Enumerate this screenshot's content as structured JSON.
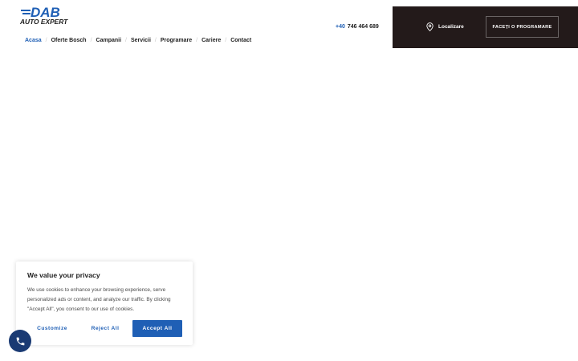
{
  "logo": {
    "brand": "DAB",
    "tagline": "AUTO EXPERT",
    "colors": {
      "blue": "#1f5fb5",
      "dark": "#1c1c1c"
    }
  },
  "nav": {
    "items": [
      {
        "label": "Acasa",
        "active": true
      },
      {
        "label": "Oferte Bosch",
        "active": false
      },
      {
        "label": "Campanii",
        "active": false
      },
      {
        "label": "Servicii",
        "active": false
      },
      {
        "label": "Programare",
        "active": false
      },
      {
        "label": "Cariere",
        "active": false
      },
      {
        "label": "Contact",
        "active": false
      }
    ],
    "separator": "/"
  },
  "phone": {
    "prefix": "+40",
    "number": "746 464 689"
  },
  "header_panel": {
    "location_label": "Localizare",
    "location_icon": "map-pin-icon",
    "appointment_label": "FACEȚI O PROGRAMARE"
  },
  "cookie_banner": {
    "title": "We value your privacy",
    "text": "We use cookies to enhance your browsing experience, serve personalized ads or content, and analyze our traffic. By clicking \"Accept All\", you consent to our use of cookies.",
    "customize_label": "Customize",
    "reject_label": "Reject All",
    "accept_label": "Accept All"
  },
  "call_button": {
    "icon": "phone-icon"
  },
  "colors": {
    "accent": "#1f5fb5",
    "panel": "#231a1a",
    "fab": "#1a3a73"
  }
}
